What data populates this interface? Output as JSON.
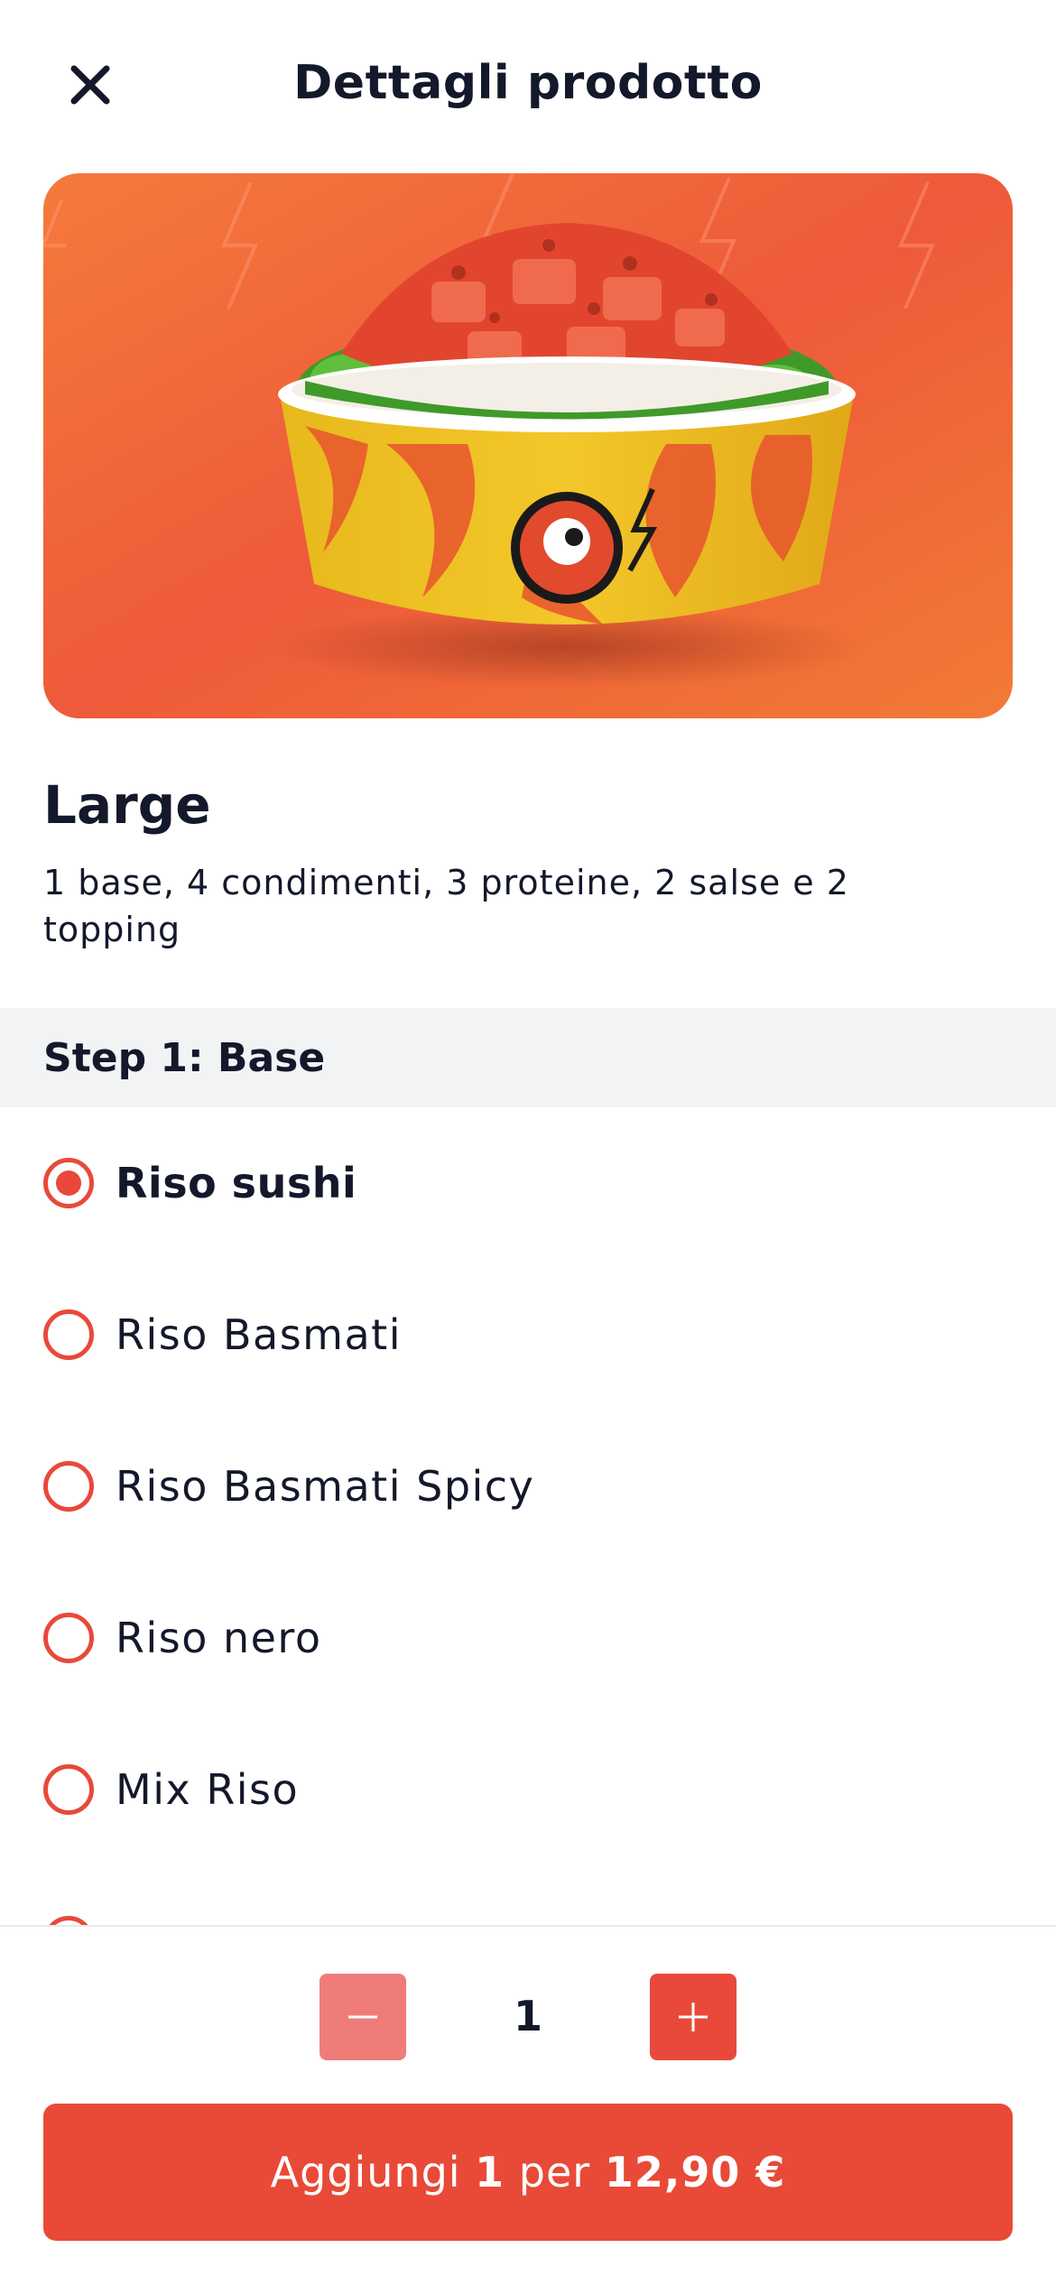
{
  "header": {
    "title": "Dettagli prodotto",
    "close_icon": "close-icon"
  },
  "product": {
    "name": "Large",
    "description": "1 base, 4 condimenti, 3 proteine, 2 salse e 2 topping",
    "image": "poke-bowl-photo"
  },
  "step": {
    "title": "Step 1: Base"
  },
  "options": [
    {
      "label": "Riso sushi",
      "selected": true
    },
    {
      "label": "Riso Basmati",
      "selected": false
    },
    {
      "label": "Riso Basmati Spicy",
      "selected": false
    },
    {
      "label": "Riso nero",
      "selected": false
    },
    {
      "label": "Mix Riso",
      "selected": false
    }
  ],
  "quantity": {
    "value": "1",
    "minus_icon": "minus-icon",
    "plus_icon": "plus-icon"
  },
  "add_button": {
    "prefix": "Aggiungi ",
    "qty": "1",
    "middle": " per ",
    "price": "12,90 €"
  },
  "colors": {
    "accent": "#e8493a",
    "accent_disabled": "#f07c7a",
    "text": "#14182b",
    "step_bg": "#f2f3f5"
  }
}
